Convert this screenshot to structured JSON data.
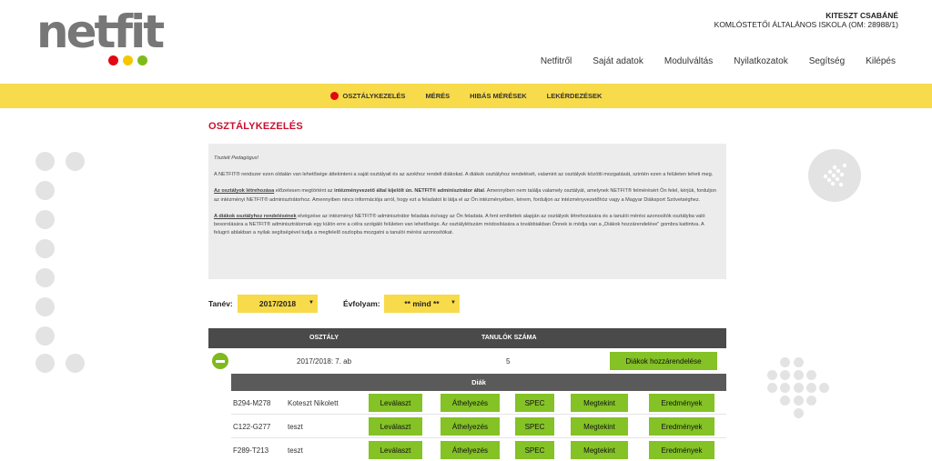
{
  "logo": {
    "text": "netfit",
    "dot_colors": [
      "#e30613",
      "#f7c600",
      "#7fba1b"
    ]
  },
  "user": {
    "name": "KITESZT CSABÁNÉ",
    "school": "KOMLÓSTETŐI ÁLTALÁNOS ISKOLA (OM: 28988/1)"
  },
  "top_nav": [
    "Netfitről",
    "Saját adatok",
    "Modulváltás",
    "Nyilatkozatok",
    "Segítség",
    "Kilépés"
  ],
  "sub_nav": [
    "OSZTÁLYKEZELÉS",
    "MÉRÉS",
    "HIBÁS MÉRÉSEK",
    "LEKÉRDEZÉSEK"
  ],
  "page_title": "OSZTÁLYKEZELÉS",
  "info": {
    "greeting": "Tisztelt Pedagógus!",
    "p1": "A NETFIT® rendszer ezen oldalán van lehetősége áttekinteni a saját osztályait és az azokhoz rendelt diákokat. A diákok osztályhoz rendelését, valamint az osztályok közötti mozgatását, szintén ezen a felületen teheti meg.",
    "p2_u": "Az osztályok létrehozása",
    "p2_a": " előzetesen megtörtént az ",
    "p2_b": "intézményvezető által kijelölt ún. NETFIT® adminisztrátor által",
    "p2_c": ". Amennyiben nem találja valamely osztályát, amelynek NETFIT® felmérésért Ön felel, kérjük, forduljon az intézményi NETFIT® adminisztrátorhoz. Amennyiben nincs információja arról, hogy ezt a feladatot ki látja el az Ön intézményében, kérem, forduljon az intézményvezetőhöz vagy a Magyar Diáksport Szövetséghez.",
    "p3_u": "A diákok osztályhoz rendelésének",
    "p3_a": " elvégzése az intézményi NETFIT® adminisztrátor feladata és/vagy az Ön feladata. A fent említettek alapján az osztályok létrehozására és a tanulói mérési azonosítók osztályba való besorolására a NETFIT® adminisztrátornak egy külön erre a célra szolgáló felületen van lehetősége. Az osztálylétszám módosítására a továbbiakban Önnek is módja van a „Diákok hozzárendelése\" gombra kattintva. A felugró ablakban a nyilak segítségével tudja a megfelelő oszlopba mozgatni a tanulói mérési azonosítókat."
  },
  "filters": {
    "year_label": "Tanév:",
    "year_value": "2017/2018",
    "grade_label": "Évfolyam:",
    "grade_value": "** mind **"
  },
  "table": {
    "col_class": "OSZTÁLY",
    "col_count": "TANULÓK SZÁMA",
    "class_name": "2017/2018: 7. ab",
    "student_count": "5",
    "assign_button": "Diákok hozzárendelése",
    "students_header": "Diák",
    "actions": [
      "Leválaszt",
      "Áthelyezés",
      "SPEC",
      "Megtekint",
      "Eredmények"
    ],
    "students": [
      {
        "id": "B294-M278",
        "name": "Koteszt Nikolett"
      },
      {
        "id": "C122-G277",
        "name": "teszt"
      },
      {
        "id": "F289-T213",
        "name": "teszt"
      }
    ]
  }
}
